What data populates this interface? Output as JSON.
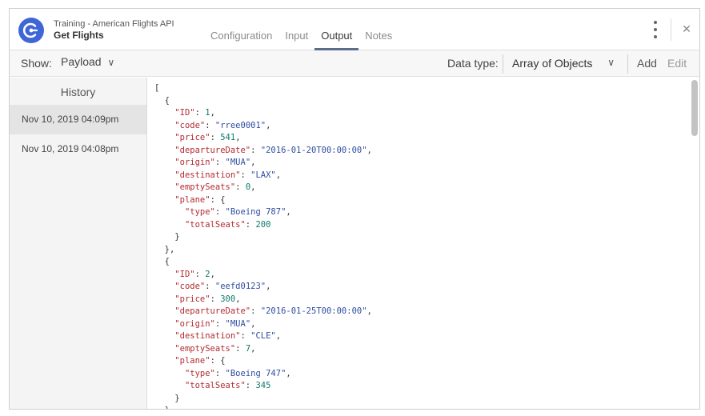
{
  "header": {
    "subtitle": "Training - American Flights API",
    "title": "Get Flights",
    "tabs": [
      {
        "label": "Configuration",
        "active": false
      },
      {
        "label": "Input",
        "active": false
      },
      {
        "label": "Output",
        "active": true
      },
      {
        "label": "Notes",
        "active": false
      }
    ],
    "close_glyph": "✕"
  },
  "toolbar": {
    "show_label": "Show:",
    "show_value": "Payload",
    "datatype_label": "Data type:",
    "datatype_value": "Array of Objects",
    "add_label": "Add",
    "edit_label": "Edit",
    "chevron": "∨"
  },
  "sidebar": {
    "title": "History",
    "items": [
      {
        "label": "Nov 10, 2019 04:09pm",
        "selected": true
      },
      {
        "label": "Nov 10, 2019 04:08pm",
        "selected": false
      }
    ]
  },
  "code_lines": [
    [
      [
        "p",
        "["
      ]
    ],
    [
      [
        "p",
        "  {"
      ]
    ],
    [
      [
        "p",
        "    "
      ],
      [
        "k",
        "\"ID\""
      ],
      [
        "p",
        ": "
      ],
      [
        "n",
        "1"
      ],
      [
        "p",
        ","
      ]
    ],
    [
      [
        "p",
        "    "
      ],
      [
        "k",
        "\"code\""
      ],
      [
        "p",
        ": "
      ],
      [
        "s",
        "\"rree0001\""
      ],
      [
        "p",
        ","
      ]
    ],
    [
      [
        "p",
        "    "
      ],
      [
        "k",
        "\"price\""
      ],
      [
        "p",
        ": "
      ],
      [
        "n",
        "541"
      ],
      [
        "p",
        ","
      ]
    ],
    [
      [
        "p",
        "    "
      ],
      [
        "k",
        "\"departureDate\""
      ],
      [
        "p",
        ": "
      ],
      [
        "s",
        "\"2016-01-20T00:00:00\""
      ],
      [
        "p",
        ","
      ]
    ],
    [
      [
        "p",
        "    "
      ],
      [
        "k",
        "\"origin\""
      ],
      [
        "p",
        ": "
      ],
      [
        "s",
        "\"MUA\""
      ],
      [
        "p",
        ","
      ]
    ],
    [
      [
        "p",
        "    "
      ],
      [
        "k",
        "\"destination\""
      ],
      [
        "p",
        ": "
      ],
      [
        "s",
        "\"LAX\""
      ],
      [
        "p",
        ","
      ]
    ],
    [
      [
        "p",
        "    "
      ],
      [
        "k",
        "\"emptySeats\""
      ],
      [
        "p",
        ": "
      ],
      [
        "n",
        "0"
      ],
      [
        "p",
        ","
      ]
    ],
    [
      [
        "p",
        "    "
      ],
      [
        "k",
        "\"plane\""
      ],
      [
        "p",
        ": {"
      ]
    ],
    [
      [
        "p",
        "      "
      ],
      [
        "k",
        "\"type\""
      ],
      [
        "p",
        ": "
      ],
      [
        "s",
        "\"Boeing 787\""
      ],
      [
        "p",
        ","
      ]
    ],
    [
      [
        "p",
        "      "
      ],
      [
        "k",
        "\"totalSeats\""
      ],
      [
        "p",
        ": "
      ],
      [
        "n",
        "200"
      ]
    ],
    [
      [
        "p",
        "    }"
      ]
    ],
    [
      [
        "p",
        "  },"
      ]
    ],
    [
      [
        "p",
        "  {"
      ]
    ],
    [
      [
        "p",
        "    "
      ],
      [
        "k",
        "\"ID\""
      ],
      [
        "p",
        ": "
      ],
      [
        "n",
        "2"
      ],
      [
        "p",
        ","
      ]
    ],
    [
      [
        "p",
        "    "
      ],
      [
        "k",
        "\"code\""
      ],
      [
        "p",
        ": "
      ],
      [
        "s",
        "\"eefd0123\""
      ],
      [
        "p",
        ","
      ]
    ],
    [
      [
        "p",
        "    "
      ],
      [
        "k",
        "\"price\""
      ],
      [
        "p",
        ": "
      ],
      [
        "n",
        "300"
      ],
      [
        "p",
        ","
      ]
    ],
    [
      [
        "p",
        "    "
      ],
      [
        "k",
        "\"departureDate\""
      ],
      [
        "p",
        ": "
      ],
      [
        "s",
        "\"2016-01-25T00:00:00\""
      ],
      [
        "p",
        ","
      ]
    ],
    [
      [
        "p",
        "    "
      ],
      [
        "k",
        "\"origin\""
      ],
      [
        "p",
        ": "
      ],
      [
        "s",
        "\"MUA\""
      ],
      [
        "p",
        ","
      ]
    ],
    [
      [
        "p",
        "    "
      ],
      [
        "k",
        "\"destination\""
      ],
      [
        "p",
        ": "
      ],
      [
        "s",
        "\"CLE\""
      ],
      [
        "p",
        ","
      ]
    ],
    [
      [
        "p",
        "    "
      ],
      [
        "k",
        "\"emptySeats\""
      ],
      [
        "p",
        ": "
      ],
      [
        "n",
        "7"
      ],
      [
        "p",
        ","
      ]
    ],
    [
      [
        "p",
        "    "
      ],
      [
        "k",
        "\"plane\""
      ],
      [
        "p",
        ": {"
      ]
    ],
    [
      [
        "p",
        "      "
      ],
      [
        "k",
        "\"type\""
      ],
      [
        "p",
        ": "
      ],
      [
        "s",
        "\"Boeing 747\""
      ],
      [
        "p",
        ","
      ]
    ],
    [
      [
        "p",
        "      "
      ],
      [
        "k",
        "\"totalSeats\""
      ],
      [
        "p",
        ": "
      ],
      [
        "n",
        "345"
      ]
    ],
    [
      [
        "p",
        "    }"
      ]
    ],
    [
      [
        "p",
        "  },"
      ]
    ]
  ],
  "colors": {
    "accent": "#3f66d8",
    "json_key": "#b22b31",
    "json_string": "#2f4ea1",
    "json_number": "#0e7a6a"
  }
}
